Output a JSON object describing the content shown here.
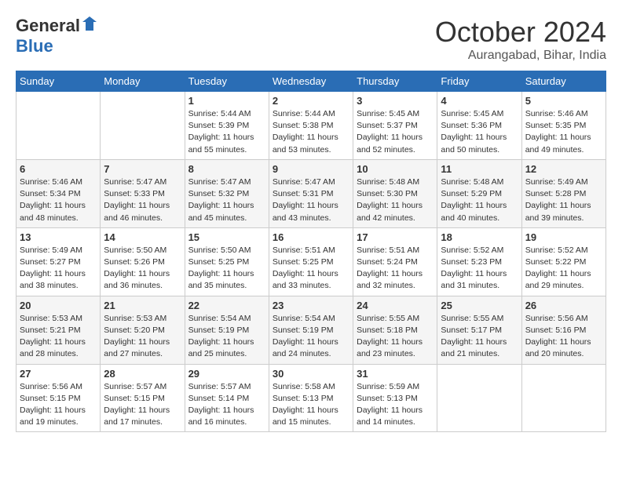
{
  "logo": {
    "general": "General",
    "blue": "Blue"
  },
  "header": {
    "month": "October 2024",
    "location": "Aurangabad, Bihar, India"
  },
  "days_of_week": [
    "Sunday",
    "Monday",
    "Tuesday",
    "Wednesday",
    "Thursday",
    "Friday",
    "Saturday"
  ],
  "weeks": [
    [
      {
        "day": "",
        "info": ""
      },
      {
        "day": "",
        "info": ""
      },
      {
        "day": "1",
        "info": "Sunrise: 5:44 AM\nSunset: 5:39 PM\nDaylight: 11 hours and 55 minutes."
      },
      {
        "day": "2",
        "info": "Sunrise: 5:44 AM\nSunset: 5:38 PM\nDaylight: 11 hours and 53 minutes."
      },
      {
        "day": "3",
        "info": "Sunrise: 5:45 AM\nSunset: 5:37 PM\nDaylight: 11 hours and 52 minutes."
      },
      {
        "day": "4",
        "info": "Sunrise: 5:45 AM\nSunset: 5:36 PM\nDaylight: 11 hours and 50 minutes."
      },
      {
        "day": "5",
        "info": "Sunrise: 5:46 AM\nSunset: 5:35 PM\nDaylight: 11 hours and 49 minutes."
      }
    ],
    [
      {
        "day": "6",
        "info": "Sunrise: 5:46 AM\nSunset: 5:34 PM\nDaylight: 11 hours and 48 minutes."
      },
      {
        "day": "7",
        "info": "Sunrise: 5:47 AM\nSunset: 5:33 PM\nDaylight: 11 hours and 46 minutes."
      },
      {
        "day": "8",
        "info": "Sunrise: 5:47 AM\nSunset: 5:32 PM\nDaylight: 11 hours and 45 minutes."
      },
      {
        "day": "9",
        "info": "Sunrise: 5:47 AM\nSunset: 5:31 PM\nDaylight: 11 hours and 43 minutes."
      },
      {
        "day": "10",
        "info": "Sunrise: 5:48 AM\nSunset: 5:30 PM\nDaylight: 11 hours and 42 minutes."
      },
      {
        "day": "11",
        "info": "Sunrise: 5:48 AM\nSunset: 5:29 PM\nDaylight: 11 hours and 40 minutes."
      },
      {
        "day": "12",
        "info": "Sunrise: 5:49 AM\nSunset: 5:28 PM\nDaylight: 11 hours and 39 minutes."
      }
    ],
    [
      {
        "day": "13",
        "info": "Sunrise: 5:49 AM\nSunset: 5:27 PM\nDaylight: 11 hours and 38 minutes."
      },
      {
        "day": "14",
        "info": "Sunrise: 5:50 AM\nSunset: 5:26 PM\nDaylight: 11 hours and 36 minutes."
      },
      {
        "day": "15",
        "info": "Sunrise: 5:50 AM\nSunset: 5:25 PM\nDaylight: 11 hours and 35 minutes."
      },
      {
        "day": "16",
        "info": "Sunrise: 5:51 AM\nSunset: 5:25 PM\nDaylight: 11 hours and 33 minutes."
      },
      {
        "day": "17",
        "info": "Sunrise: 5:51 AM\nSunset: 5:24 PM\nDaylight: 11 hours and 32 minutes."
      },
      {
        "day": "18",
        "info": "Sunrise: 5:52 AM\nSunset: 5:23 PM\nDaylight: 11 hours and 31 minutes."
      },
      {
        "day": "19",
        "info": "Sunrise: 5:52 AM\nSunset: 5:22 PM\nDaylight: 11 hours and 29 minutes."
      }
    ],
    [
      {
        "day": "20",
        "info": "Sunrise: 5:53 AM\nSunset: 5:21 PM\nDaylight: 11 hours and 28 minutes."
      },
      {
        "day": "21",
        "info": "Sunrise: 5:53 AM\nSunset: 5:20 PM\nDaylight: 11 hours and 27 minutes."
      },
      {
        "day": "22",
        "info": "Sunrise: 5:54 AM\nSunset: 5:19 PM\nDaylight: 11 hours and 25 minutes."
      },
      {
        "day": "23",
        "info": "Sunrise: 5:54 AM\nSunset: 5:19 PM\nDaylight: 11 hours and 24 minutes."
      },
      {
        "day": "24",
        "info": "Sunrise: 5:55 AM\nSunset: 5:18 PM\nDaylight: 11 hours and 23 minutes."
      },
      {
        "day": "25",
        "info": "Sunrise: 5:55 AM\nSunset: 5:17 PM\nDaylight: 11 hours and 21 minutes."
      },
      {
        "day": "26",
        "info": "Sunrise: 5:56 AM\nSunset: 5:16 PM\nDaylight: 11 hours and 20 minutes."
      }
    ],
    [
      {
        "day": "27",
        "info": "Sunrise: 5:56 AM\nSunset: 5:15 PM\nDaylight: 11 hours and 19 minutes."
      },
      {
        "day": "28",
        "info": "Sunrise: 5:57 AM\nSunset: 5:15 PM\nDaylight: 11 hours and 17 minutes."
      },
      {
        "day": "29",
        "info": "Sunrise: 5:57 AM\nSunset: 5:14 PM\nDaylight: 11 hours and 16 minutes."
      },
      {
        "day": "30",
        "info": "Sunrise: 5:58 AM\nSunset: 5:13 PM\nDaylight: 11 hours and 15 minutes."
      },
      {
        "day": "31",
        "info": "Sunrise: 5:59 AM\nSunset: 5:13 PM\nDaylight: 11 hours and 14 minutes."
      },
      {
        "day": "",
        "info": ""
      },
      {
        "day": "",
        "info": ""
      }
    ]
  ]
}
